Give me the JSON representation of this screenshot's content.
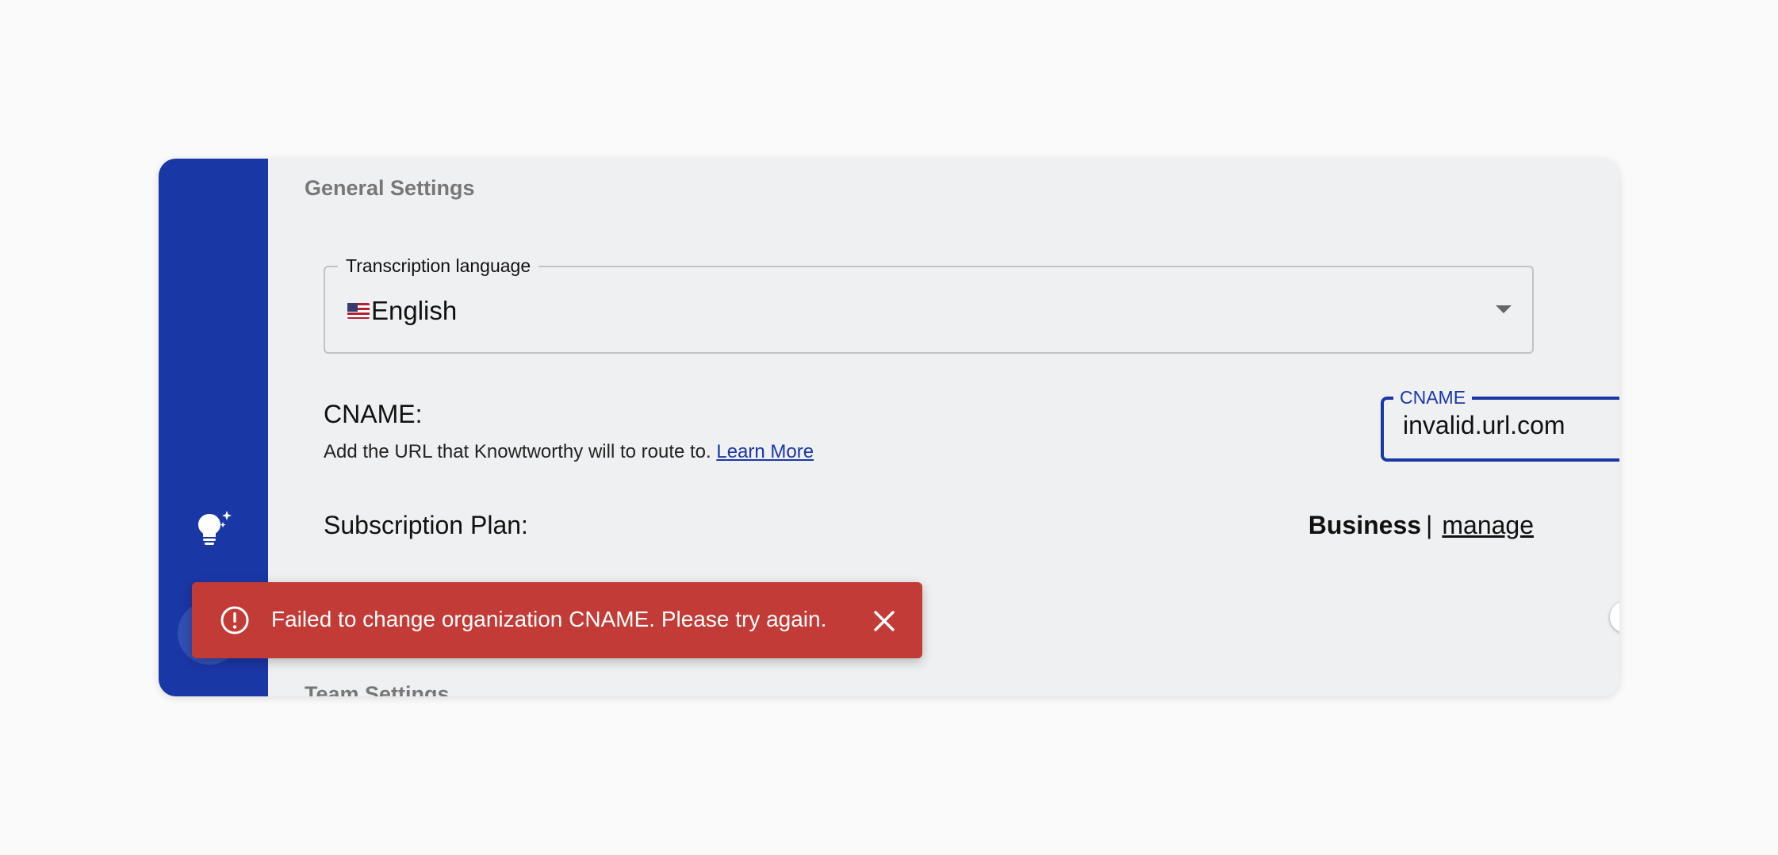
{
  "general": {
    "section_title": "General Settings",
    "language": {
      "label": "Transcription language",
      "value": "English"
    },
    "cname": {
      "title": "CNAME:",
      "help_text": "Add the URL that Knowtworthy will to route to. ",
      "learn_more": "Learn More",
      "input_label": "CNAME",
      "input_value": "invalid.url.com"
    },
    "subscription": {
      "title": "Subscription Plan:",
      "plan": "Business",
      "separator": "|",
      "manage": "manage"
    },
    "toggle_on": false
  },
  "team": {
    "section_title": "Team Settings"
  },
  "snackbar": {
    "message": "Failed to change organization CNAME. Please try again."
  },
  "colors": {
    "sidebar": "#1a37a6",
    "error": "#c23b36",
    "accent": "#1a37a6"
  },
  "icons": [
    "lightbulb-sparkle-icon",
    "us-flag-icon",
    "chevron-down-icon",
    "error-icon",
    "close-icon"
  ]
}
